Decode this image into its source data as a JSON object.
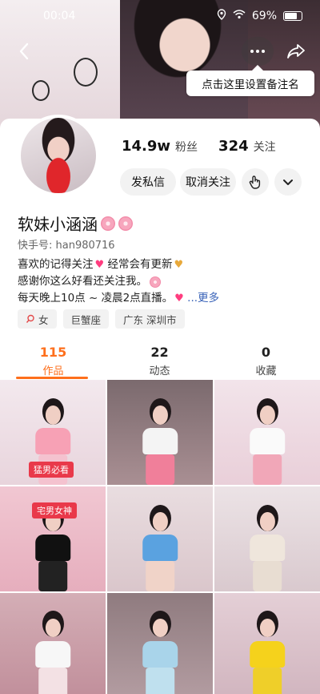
{
  "status_bar": {
    "time": "00:04",
    "battery": "69%"
  },
  "tooltip": "点击这里设置备注名",
  "profile": {
    "name": "软妹小涵涵",
    "kuaishou_id": "快手号: han980716",
    "stats": {
      "fans_count": "14.9w",
      "fans_label": "粉丝",
      "following_count": "324",
      "following_label": "关注"
    },
    "buttons": {
      "message": "发私信",
      "unfollow": "取消关注"
    },
    "bio": [
      "喜欢的记得关注",
      "经常会有更新",
      "感谢你这么好看还关注我。",
      "每天晚上10点 ~ 凌晨2点直播。",
      "...更多"
    ],
    "tags": [
      "女",
      "巨蟹座",
      "广东 深圳市"
    ]
  },
  "tabs": [
    {
      "count": "115",
      "label": "作品"
    },
    {
      "count": "22",
      "label": "动态"
    },
    {
      "count": "0",
      "label": "收藏"
    }
  ],
  "grid_badges": {
    "cell1": "猛男必看",
    "cell4": "宅男女神"
  },
  "colors": {
    "accent": "#fe6f1c",
    "link": "#3a63b8",
    "heart": "#ff3d7f"
  },
  "icons": [
    "back-icon",
    "more-icon",
    "share-icon",
    "touch-icon",
    "chevron-down-icon",
    "search-tag-icon"
  ]
}
